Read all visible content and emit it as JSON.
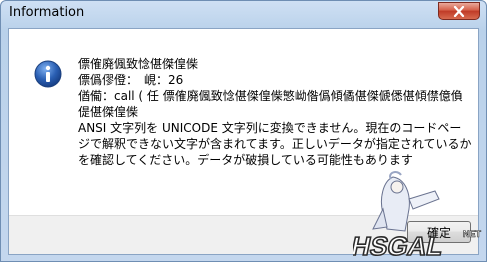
{
  "window": {
    "title": "Information",
    "close_icon": "close-icon"
  },
  "dialog": {
    "icon": "info-icon",
    "accent_color": "#2a5fb3",
    "message_lines": [
      "僄傕廃偑致惗偡傑偟偨",
      "僄僞僇僜：　峴：26",
      "偤僃：call ( 任 僄傕廃偑致惗偡傑偟偨慜岰偺僞傾僪偡傑傂僁偡傾僸億偩偍偡傑偟偨",
      "ANSI 文字列を UNICODE 文字列に変換できません。現在のコードページで解釈できない文字が含まれてます。正しいデータが指定されているかを確認してください。データが破損している可能性もあります"
    ],
    "ok_label": "確定"
  },
  "watermark": {
    "logo_text": "HSGAL",
    "logo_suffix": "NET"
  }
}
